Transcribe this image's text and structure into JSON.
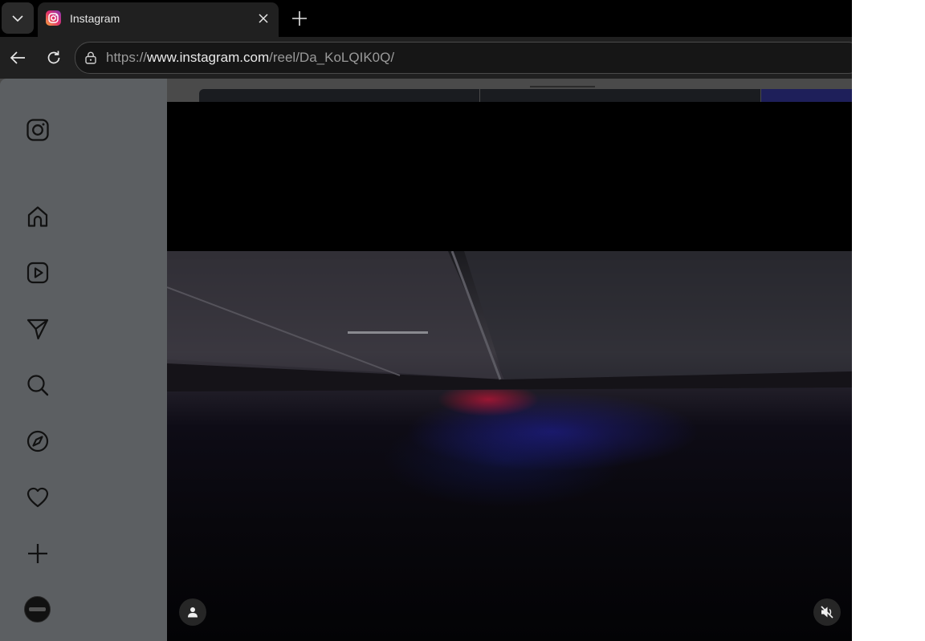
{
  "browser": {
    "tab": {
      "title": "Instagram",
      "favicon": "instagram-icon"
    },
    "toolbar": {
      "url_scheme": "https://",
      "url_host": "www.instagram.com",
      "url_path": "/reel/Da_KoLQIK0Q/"
    }
  },
  "sidebar": {
    "items": [
      {
        "icon": "instagram-logo-icon"
      },
      {
        "icon": "home-icon"
      },
      {
        "icon": "reels-icon"
      },
      {
        "icon": "messages-icon"
      },
      {
        "icon": "search-icon"
      },
      {
        "icon": "explore-icon"
      },
      {
        "icon": "notifications-icon"
      },
      {
        "icon": "create-icon"
      },
      {
        "icon": "profile-avatar"
      }
    ]
  },
  "video": {
    "controls": [
      "user-icon",
      "muted-icon"
    ]
  },
  "colors": {
    "sidebar_bg": "#5c5f62",
    "video_bg": "#000000",
    "tabstrip_bg": "#000000"
  }
}
